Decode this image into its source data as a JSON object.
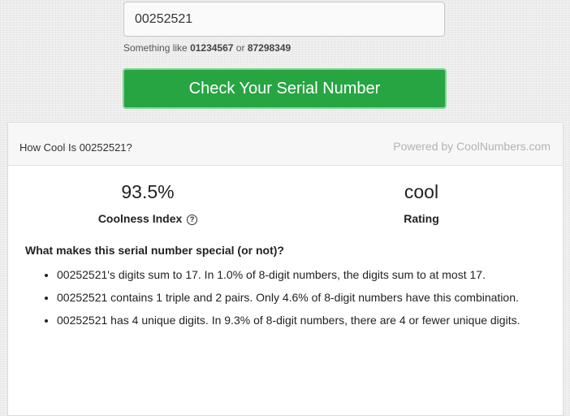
{
  "search": {
    "value": "00252521"
  },
  "hint": {
    "prefix": "Something like",
    "example1": "01234567",
    "separator": "or",
    "example2": "87298349"
  },
  "check_button": {
    "label": "Check Your Serial Number"
  },
  "result": {
    "title": "How Cool Is 00252521?",
    "powered_by": "Powered by CoolNumbers.com",
    "coolness": {
      "value": "93.5%",
      "label": "Coolness Index",
      "help_glyph": "?"
    },
    "rating": {
      "value": "cool",
      "label": "Rating"
    },
    "special_heading": "What makes this serial number special (or not)?",
    "reasons": [
      "00252521's digits sum to 17. In 1.0% of 8-digit numbers, the digits sum to at most 17.",
      "00252521 contains 1 triple and 2 pairs. Only 4.6% of 8-digit numbers have this combination.",
      "00252521 has 4 unique digits. In 9.3% of 8-digit numbers, there are 4 or fewer unique digits."
    ]
  },
  "colors": {
    "button": "#27a543",
    "button_border": "#7bd88f",
    "powered_by": "#b3b3b3"
  }
}
